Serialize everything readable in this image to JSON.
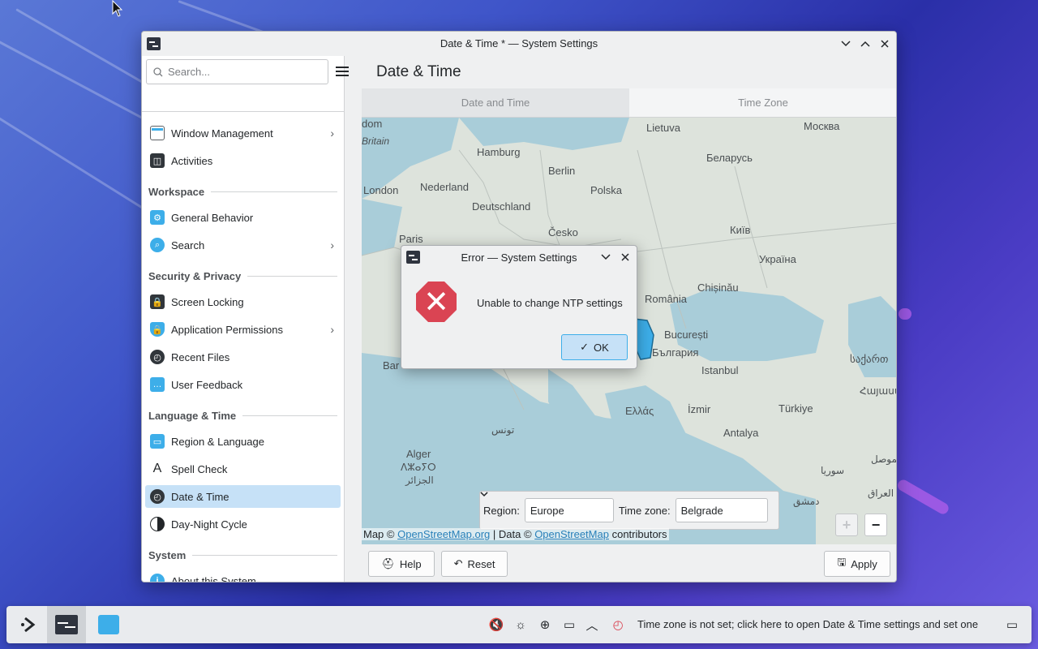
{
  "window": {
    "title": "Date & Time * — System Settings",
    "minimize_icon": "chevron-down-icon",
    "maximize_icon": "chevron-up-icon",
    "close_icon": "close-icon"
  },
  "sidebar": {
    "search_placeholder": "Search...",
    "items": [
      {
        "label": "Window Management",
        "icon": "window-icon",
        "chevron": true
      },
      {
        "label": "Activities",
        "icon": "activities-icon",
        "chevron": false
      },
      {
        "heading": "Workspace"
      },
      {
        "label": "General Behavior",
        "icon": "general-behavior-icon",
        "chevron": false
      },
      {
        "label": "Search",
        "icon": "search-icon",
        "chevron": true
      },
      {
        "heading": "Security & Privacy"
      },
      {
        "label": "Screen Locking",
        "icon": "screen-lock-icon",
        "chevron": false
      },
      {
        "label": "Application Permissions",
        "icon": "shield-icon",
        "chevron": true
      },
      {
        "label": "Recent Files",
        "icon": "clock-icon",
        "chevron": false
      },
      {
        "label": "User Feedback",
        "icon": "feedback-icon",
        "chevron": false
      },
      {
        "heading": "Language & Time"
      },
      {
        "label": "Region & Language",
        "icon": "region-icon",
        "chevron": false
      },
      {
        "label": "Spell Check",
        "icon": "spell-check-icon",
        "chevron": false
      },
      {
        "label": "Date & Time",
        "icon": "clock-icon",
        "chevron": false,
        "active": true
      },
      {
        "label": "Day-Night Cycle",
        "icon": "day-night-icon",
        "chevron": false
      },
      {
        "heading": "System"
      },
      {
        "label": "About this System",
        "icon": "info-icon",
        "chevron": false
      }
    ]
  },
  "content": {
    "page_title": "Date & Time",
    "tabs": [
      "Date and Time",
      "Time Zone"
    ],
    "map_labels": [
      "dom",
      "Britain",
      "Hamburg",
      "Berlin",
      "Lietuva",
      "Москва",
      "Беларусь",
      "London",
      "Nederland",
      "Polska",
      "Deutschland",
      "Paris",
      "Česko",
      "Київ",
      "Україна",
      "Chișinău",
      "România",
      "București",
      "България",
      "Bar",
      "Istanbul",
      "საქართ",
      "Ελλάς",
      "İzmir",
      "Türkiye",
      "Հայաստ",
      "Antalya",
      "تونس",
      "Alger",
      "ⴷⵣⴰⵢⵔ",
      "الجزائر",
      "سوريا",
      "الموصل",
      "العراق",
      "دمشق"
    ],
    "attribution": {
      "prefix": "Map ©",
      "osm_link": "OpenStreetMap.org",
      "data": "| Data ©",
      "osm_link2": "OpenStreetMap",
      "suffix": "contributors"
    },
    "region_label": "Region:",
    "region_value": "Europe",
    "timezone_label": "Time zone:",
    "timezone_value": "Belgrade",
    "zoom_in": "+",
    "zoom_out": "−",
    "help_label": "Help",
    "reset_label": "Reset",
    "apply_label": "Apply"
  },
  "dialog": {
    "title": "Error — System Settings",
    "message": "Unable to change NTP settings",
    "ok_label": "OK"
  },
  "taskbar": {
    "status_text": "Time zone is not set; click here to open Date & Time settings and set one"
  },
  "colors": {
    "accent": "#3daee9",
    "selection": "#c6e1f7",
    "error": "#da4453"
  }
}
